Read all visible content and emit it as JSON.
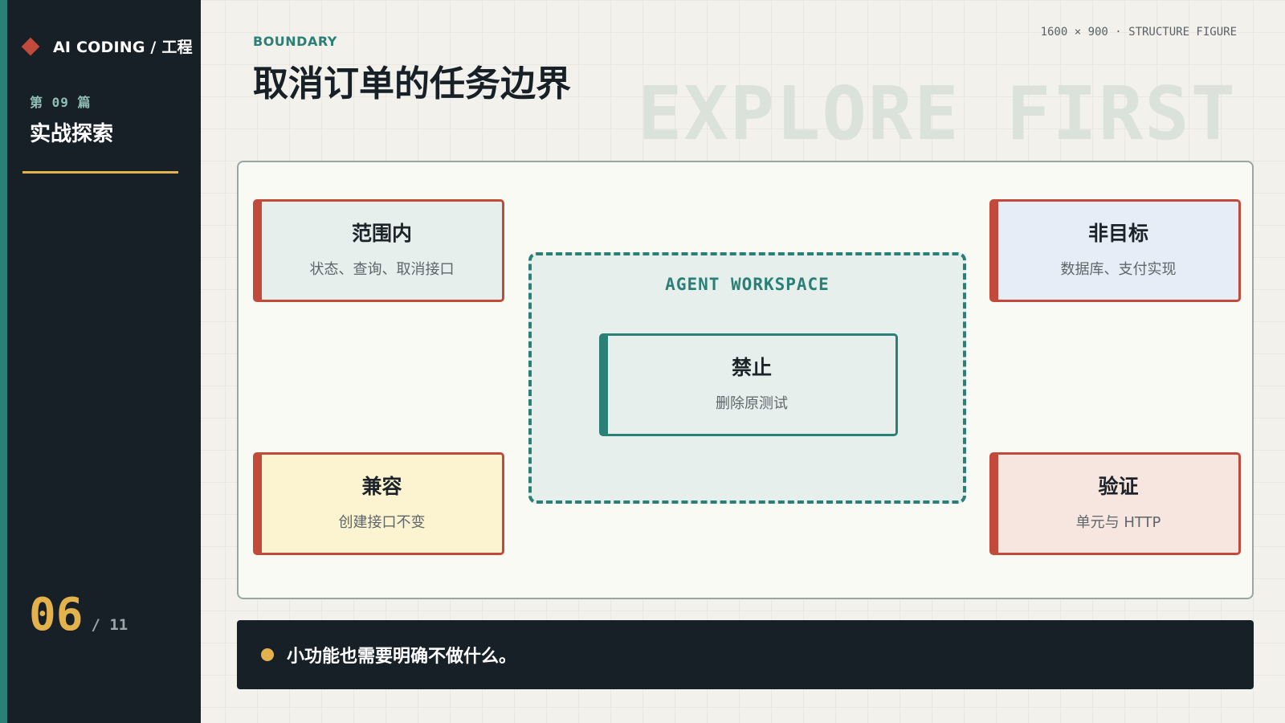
{
  "sidebar": {
    "brand": "AI CODING / 工程",
    "issue": "第 09 篇",
    "section": "实战探索",
    "page_current": "06",
    "page_total": "/ 11"
  },
  "header": {
    "eyebrow": "BOUNDARY",
    "title": "取消订单的任务边界",
    "meta": "1600 × 900 · STRUCTURE FIGURE",
    "watermark": "EXPLORE FIRST"
  },
  "diagram": {
    "scope": {
      "title": "范围内",
      "subtitle": "状态、查询、取消接口"
    },
    "non_goal": {
      "title": "非目标",
      "subtitle": "数据库、支付实现"
    },
    "compat": {
      "title": "兼容",
      "subtitle": "创建接口不变"
    },
    "verify": {
      "title": "验证",
      "subtitle": "单元与 HTTP"
    },
    "workspace": {
      "label": "AGENT WORKSPACE",
      "forbidden": {
        "title": "禁止",
        "subtitle": "删除原测试"
      }
    }
  },
  "note": {
    "text": "小功能也需要明确不做什么。"
  },
  "colors": {
    "teal": "#2a8077",
    "red": "#c24a3a",
    "gold": "#e3b24d",
    "dark": "#182027"
  }
}
